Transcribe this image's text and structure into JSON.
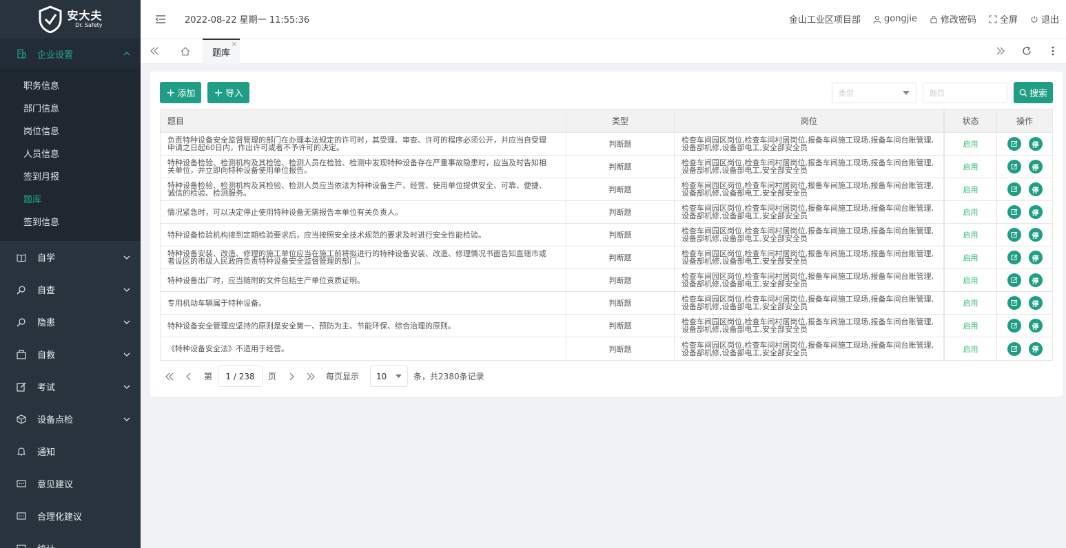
{
  "brand": {
    "name_cn": "安大夫",
    "name_en": "Dr. Safety"
  },
  "header": {
    "datetime": "2022-08-22 星期一 11:55:36",
    "project": "金山工业区项目部",
    "user": "gongjie",
    "change_password": "修改密码",
    "fullscreen": "全屏",
    "logout": "退出"
  },
  "sidebar": {
    "open_group": {
      "label": "企业设置",
      "icon": "building-icon"
    },
    "sub_items": [
      "职务信息",
      "部门信息",
      "岗位信息",
      "人员信息",
      "签到月报",
      "题库",
      "签到信息"
    ],
    "active_sub": "题库",
    "items": [
      {
        "label": "自学",
        "icon": "book-icon",
        "expand": true
      },
      {
        "label": "自查",
        "icon": "search-icon",
        "expand": true
      },
      {
        "label": "隐患",
        "icon": "search-icon",
        "expand": true
      },
      {
        "label": "自救",
        "icon": "kit-icon",
        "expand": true
      },
      {
        "label": "考试",
        "icon": "edit-icon",
        "expand": true
      },
      {
        "label": "设备点检",
        "icon": "cube-icon",
        "expand": true
      },
      {
        "label": "通知",
        "icon": "bell-icon",
        "expand": false
      },
      {
        "label": "意见建议",
        "icon": "comment-icon",
        "expand": false
      },
      {
        "label": "合理化建议",
        "icon": "comment-icon",
        "expand": false
      },
      {
        "label": "统计",
        "icon": "chart-icon",
        "expand": false
      }
    ]
  },
  "tabs": {
    "active": "题库"
  },
  "toolbar": {
    "add_label": "添加",
    "import_label": "导入",
    "type_placeholder": "类型",
    "title_placeholder": "题目",
    "search_label": "搜索"
  },
  "table": {
    "headers": [
      "题目",
      "类型",
      "岗位",
      "状态",
      "操作"
    ],
    "rows": [
      {
        "title_l1": "负责特种设备安全监督管理的部门在办理本法规定的许可时，其受理、审查、许可的程序必须公开，并应当自受理",
        "title_l2": "申请之日起60日内，作出许可或者不予许可的决定。",
        "type": "判断题",
        "post_l1": "检查车间园区岗位,检查车间村居岗位,报备车间施工现场,报备车间台账管理,",
        "post_l2": "设备部机修,设备部电工,安全部安全员",
        "status": "启用"
      },
      {
        "title_l1": "特种设备检验、检测机构及其检验、检测人员在检验、检测中发现特种设备存在严重事故隐患时，应当及时告知相",
        "title_l2": "关单位，并立即向特种设备使用单位报告。",
        "type": "判断题",
        "post_l1": "检查车间园区岗位,检查车间村居岗位,报备车间施工现场,报备车间台账管理,",
        "post_l2": "设备部机修,设备部电工,安全部安全员",
        "status": "启用"
      },
      {
        "title_l1": "特种设备检验、检测机构及其检验、检测人员应当依法为特种设备生产、经营、使用单位提供安全、可靠、便捷、",
        "title_l2": "诚信的检验、检测服务。",
        "type": "判断题",
        "post_l1": "检查车间园区岗位,检查车间村居岗位,报备车间施工现场,报备车间台账管理,",
        "post_l2": "设备部机修,设备部电工,安全部安全员",
        "status": "启用"
      },
      {
        "title_l1": "情况紧急时，可以决定停止使用特种设备无需报告本单位有关负责人。",
        "title_l2": "",
        "type": "判断题",
        "post_l1": "检查车间园区岗位,检查车间村居岗位,报备车间施工现场,报备车间台账管理,",
        "post_l2": "设备部机修,设备部电工,安全部安全员",
        "status": "启用"
      },
      {
        "title_l1": "特种设备检验机构接到定期检验要求后，应当按照安全技术规范的要求及时进行安全性能检验。",
        "title_l2": "",
        "type": "判断题",
        "post_l1": "检查车间园区岗位,检查车间村居岗位,报备车间施工现场,报备车间台账管理,",
        "post_l2": "设备部机修,设备部电工,安全部安全员",
        "status": "启用"
      },
      {
        "title_l1": "特种设备安装、改造、修理的施工单位应当在施工前将拟进行的特种设备安装、改造、修理情况书面告知直辖市或",
        "title_l2": "者设区的市级人民政府负责特种设备安全监督管理的部门。",
        "type": "判断题",
        "post_l1": "检查车间园区岗位,检查车间村居岗位,报备车间施工现场,报备车间台账管理,",
        "post_l2": "设备部机修,设备部电工,安全部安全员",
        "status": "启用"
      },
      {
        "title_l1": "特种设备出厂时，应当随附的文件包括生产单位资质证明。",
        "title_l2": "",
        "type": "判断题",
        "post_l1": "检查车间园区岗位,检查车间村居岗位,报备车间施工现场,报备车间台账管理,",
        "post_l2": "设备部机修,设备部电工,安全部安全员",
        "status": "启用"
      },
      {
        "title_l1": "专用机动车辆属于特种设备。",
        "title_l2": "",
        "type": "判断题",
        "post_l1": "检查车间园区岗位,检查车间村居岗位,报备车间施工现场,报备车间台账管理,",
        "post_l2": "设备部机修,设备部电工,安全部安全员",
        "status": "启用"
      },
      {
        "title_l1": "特种设备安全管理应坚持的原则是安全第一、预防为主、节能环保、综合治理的原则。",
        "title_l2": "",
        "type": "判断题",
        "post_l1": "检查车间园区岗位,检查车间村居岗位,报备车间施工现场,报备车间台账管理,",
        "post_l2": "设备部机修,设备部电工,安全部安全员",
        "status": "启用"
      },
      {
        "title_l1": "《特种设备安全法》不适用于经营。",
        "title_l2": "",
        "type": "判断题",
        "post_l1": "检查车间园区岗位,检查车间村居岗位,报备车间施工现场,报备车间台账管理,",
        "post_l2": "设备部机修,设备部电工,安全部安全员",
        "status": "启用"
      }
    ],
    "edit_icon": "edit-icon",
    "stop_label": "停"
  },
  "pagination": {
    "page_prefix": "第",
    "page_value": "1 / 238",
    "page_suffix": "页",
    "per_page_label": "每页显示",
    "per_page": "10",
    "total_text": "条，共2380条记录"
  },
  "colors": {
    "accent": "#1f9e85",
    "sidebar_bg": "#28333e",
    "status_green": "#2fbf6f"
  }
}
